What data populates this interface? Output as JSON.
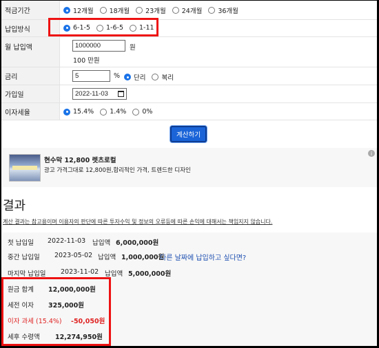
{
  "form": {
    "period": {
      "label": "적금기간",
      "options": [
        "12개월",
        "18개월",
        "23개월",
        "24개월",
        "36개월"
      ],
      "selected": 0
    },
    "method": {
      "label": "납입방식",
      "options": [
        "6-1-5",
        "1-6-5",
        "1-11"
      ],
      "selected": 0
    },
    "monthly": {
      "label": "월 납입액",
      "value": "1000000",
      "unit": "원",
      "hint": "100 만원"
    },
    "rate": {
      "label": "금리",
      "value": "5",
      "unit": "%",
      "options": [
        "단리",
        "복리"
      ],
      "selected": 0
    },
    "join_date": {
      "label": "가입일",
      "value": "2022-11-03"
    },
    "tax": {
      "label": "이자세율",
      "options": [
        "15.4%",
        "1.4%",
        "0%"
      ],
      "selected": 0
    }
  },
  "calc_button": "계산하기",
  "ad": {
    "title": "현수막 12,800 렛츠로컬",
    "desc": "광고 가격그대로 12,800원,합리적인 가격, 트렌드한 디자인",
    "info": "i"
  },
  "result": {
    "title": "결과",
    "disclaimer": "계산 결과는 참고용이며 이용자의 판단에 따른 투자수익 및 정보의 오류등에 따른 손익에 대해서는 책임지지 않습니다.",
    "payments": [
      {
        "label": "첫 납입일",
        "date": "2022-11-03",
        "amount_label": "납입액",
        "amount": "6,000,000원"
      },
      {
        "label": "중간 납입일",
        "date": "2023-05-02",
        "amount_label": "납입액",
        "amount": "1,000,000원",
        "link": "다른 날짜에 납입하고 싶다면?"
      },
      {
        "label": "마지막 납입일",
        "date": "2023-11-02",
        "amount_label": "납입액",
        "amount": "5,000,000원"
      }
    ],
    "summary": [
      {
        "label": "원금 합계",
        "value": "12,000,000원"
      },
      {
        "label": "세전 이자",
        "value": "325,000원"
      },
      {
        "label": "이자 과세 (15.4%)",
        "value": "-50,050원"
      },
      {
        "label": "세후 수령액",
        "value": "12,274,950원"
      }
    ]
  },
  "colors": {
    "accent": "#1a73e8",
    "button": "#1a64d8",
    "highlight_box": "#e11111",
    "tax_red": "#e02424",
    "link": "#1d4fb0"
  }
}
